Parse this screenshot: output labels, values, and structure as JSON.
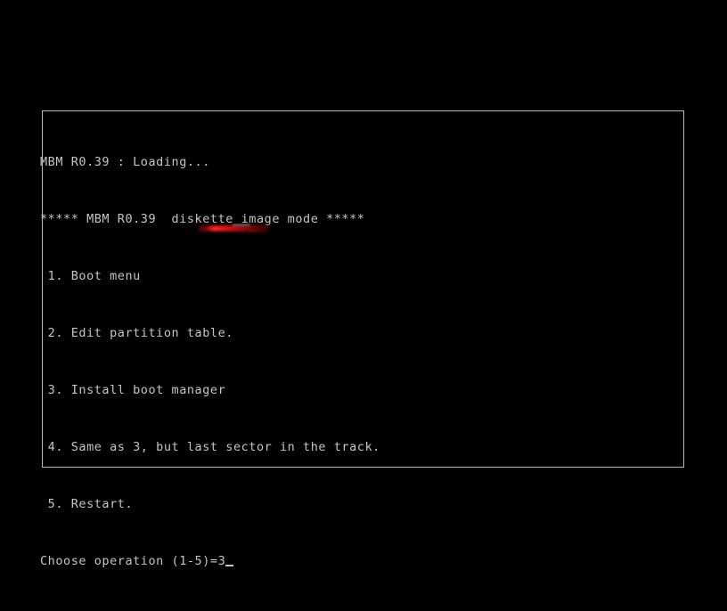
{
  "screen": {
    "background_color": "#000000",
    "text_color": "#c4c4c4",
    "border_color": "#b8b8b8",
    "accent_color": "#e01010"
  },
  "console": {
    "lines": [
      "MBM R0.39 : Loading...",
      "***** MBM R0.39  diskette image mode *****",
      " 1. Boot menu",
      " 2. Edit partition table.",
      " 3. Install boot manager",
      " 4. Same as 3, but last sector in the track.",
      " 5. Restart."
    ],
    "loading_line": "MBM R0.39 : Loading...",
    "banner_line": "***** MBM R0.39  diskette image mode *****",
    "menu_items": [
      " 1. Boot menu",
      " 2. Edit partition table.",
      " 3. Install boot manager",
      " 4. Same as 3, but last sector in the track.",
      " 5. Restart."
    ],
    "prompt": {
      "label": "Choose operation (1-5)=",
      "value": "3",
      "full_text": "Choose operation (1-5)=3"
    }
  },
  "annotation": {
    "type": "redaction-smear",
    "color": "#e01010"
  }
}
